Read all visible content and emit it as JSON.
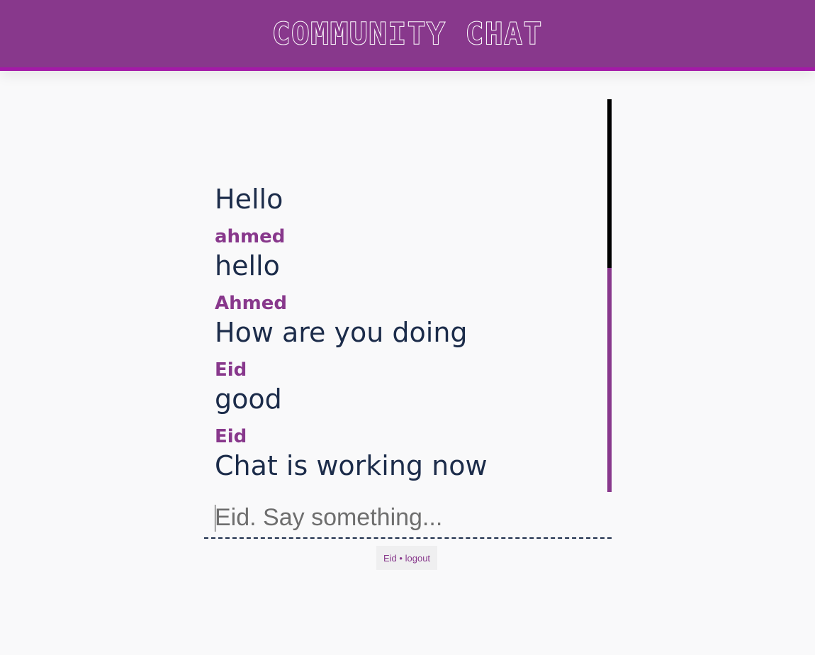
{
  "header": {
    "title": "COMMUNITY CHAT"
  },
  "messages": [
    {
      "user": "",
      "text": "Hello"
    },
    {
      "user": "ahmed",
      "text": "hello"
    },
    {
      "user": "Ahmed",
      "text": "How are you doing"
    },
    {
      "user": "Eid",
      "text": "good"
    },
    {
      "user": "Eid",
      "text": "Chat is working now"
    }
  ],
  "scroll": {
    "position_fraction": 0.43
  },
  "composer": {
    "placeholder": "Eid. Say something...",
    "value": ""
  },
  "footer": {
    "username": "Eid",
    "separator": "•",
    "logout_label": "logout"
  },
  "colors": {
    "brand": "#88388c",
    "brand_border": "#a419a8",
    "text": "#1c2c4a",
    "background": "#f9f9fa"
  }
}
